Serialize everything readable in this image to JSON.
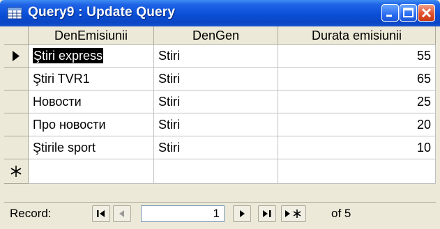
{
  "window": {
    "title": "Query9 : Update Query",
    "icon": "datasheet-icon"
  },
  "columns": [
    "DenEmisiunii",
    "DenGen",
    "Durata emisiunii"
  ],
  "rows": [
    {
      "den_emisiunii": "Ştiri express",
      "den_gen": "Stiri",
      "durata": "55"
    },
    {
      "den_emisiunii": "Ştiri TVR1",
      "den_gen": "Stiri",
      "durata": "65"
    },
    {
      "den_emisiunii": "Новости",
      "den_gen": "Stiri",
      "durata": "25"
    },
    {
      "den_emisiunii": "Про новости",
      "den_gen": "Stiri",
      "durata": "20"
    },
    {
      "den_emisiunii": "Ştirile sport",
      "den_gen": "Stiri",
      "durata": "10"
    }
  ],
  "current_row_marker": "▶",
  "new_row_marker": "✱",
  "navigator": {
    "label": "Record:",
    "current_record": "1",
    "of_text": "of 5"
  }
}
